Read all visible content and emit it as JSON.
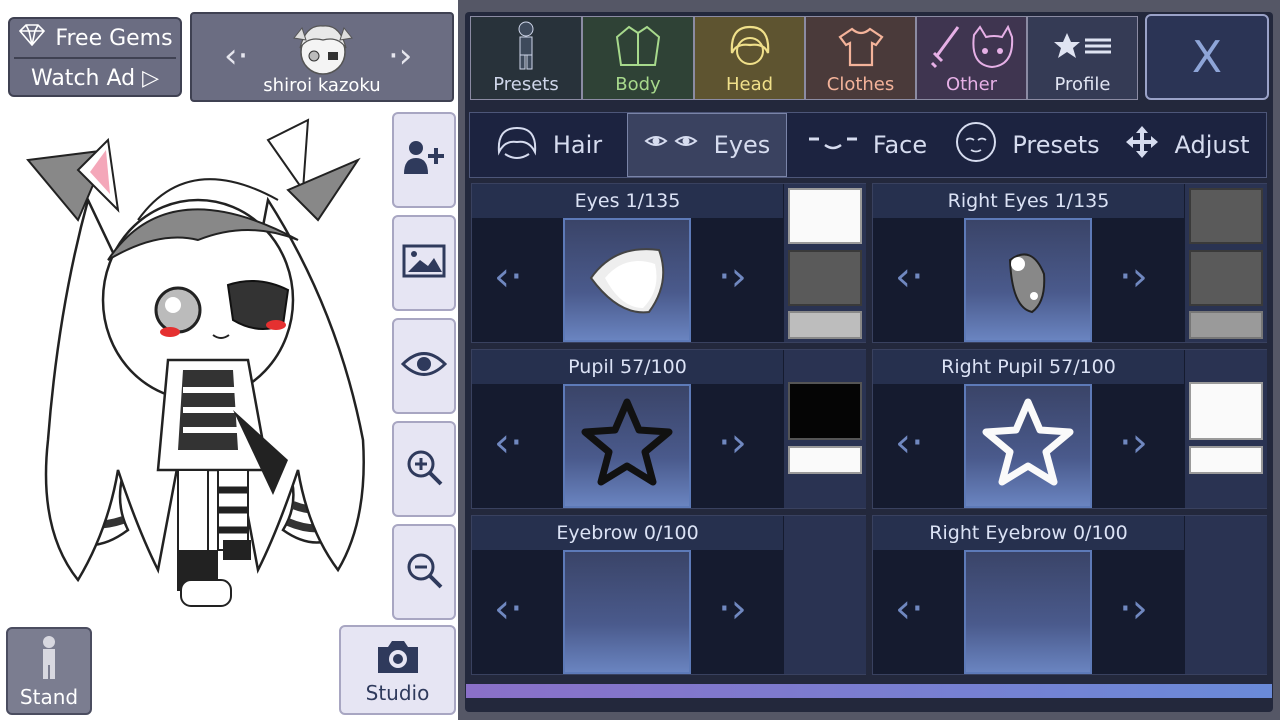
{
  "gems": {
    "free_gems": "Free Gems",
    "watch_ad": "Watch Ad ▷"
  },
  "character": {
    "name": "shiroi kazoku"
  },
  "side_buttons": [
    "add-character",
    "background",
    "visibility",
    "zoom-in",
    "zoom-out"
  ],
  "stand": {
    "label": "Stand"
  },
  "studio": {
    "label": "Studio"
  },
  "categories": [
    {
      "label": "Presets",
      "color": "#cfd6ea",
      "bg": "#28323a"
    },
    {
      "label": "Body",
      "color": "#a7d98c",
      "bg": "#2f4236"
    },
    {
      "label": "Head",
      "color": "#f0e08a",
      "bg": "#5e5430"
    },
    {
      "label": "Clothes",
      "color": "#f4b39a",
      "bg": "#4a3a3a"
    },
    {
      "label": "Other",
      "color": "#e6b0e6",
      "bg": "#3f3550"
    },
    {
      "label": "Profile",
      "color": "#e0e4f2",
      "bg": "#353b55"
    }
  ],
  "close_label": "X",
  "subtabs": [
    {
      "label": "Hair",
      "active": false
    },
    {
      "label": "Eyes",
      "active": true
    },
    {
      "label": "Face",
      "active": false
    },
    {
      "label": "Presets",
      "active": false
    },
    {
      "label": "Adjust",
      "active": false
    }
  ],
  "cells": {
    "eyes": "Eyes 1/135",
    "right_eyes": "Right Eyes 1/135",
    "pupil": "Pupil 57/100",
    "right_pupil": "Right Pupil 57/100",
    "eyebrow": "Eyebrow 0/100",
    "right_eyebrow": "Right Eyebrow 0/100"
  },
  "colors": {
    "accent": "#6a84c0",
    "panel": "#23283c"
  }
}
